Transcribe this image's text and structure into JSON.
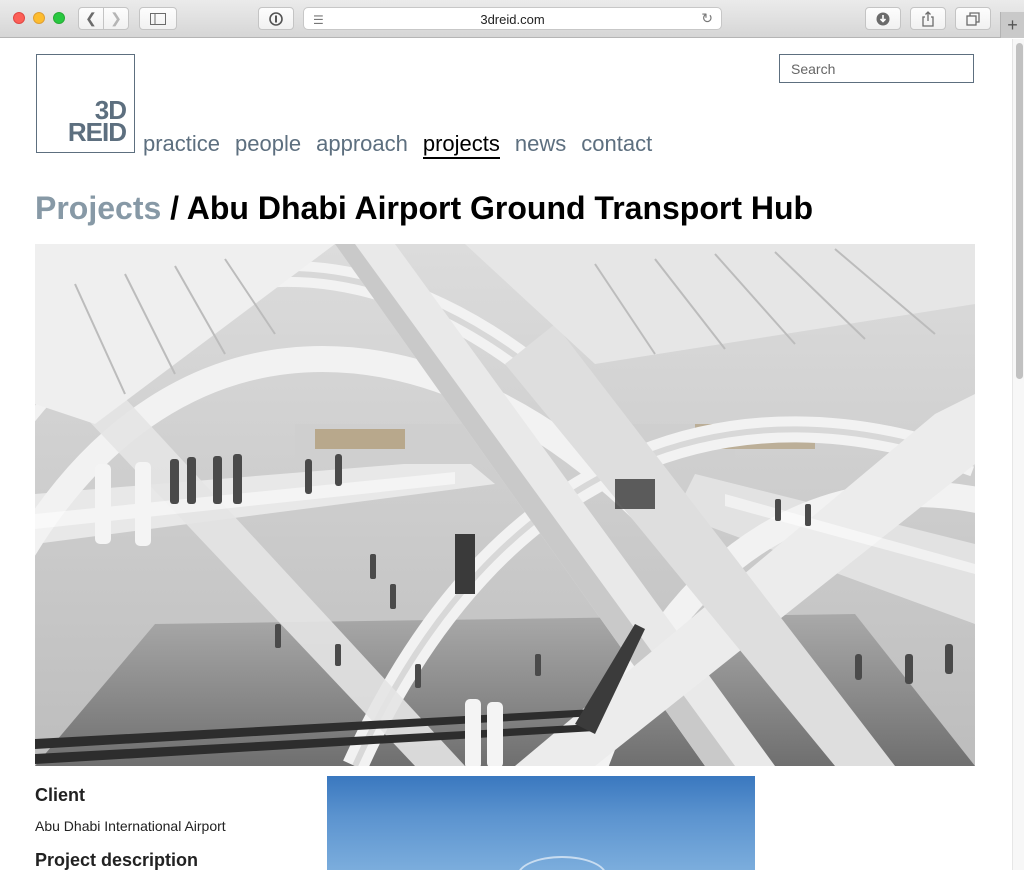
{
  "browser": {
    "url": "3dreid.com",
    "icons": {
      "back": "chevron-left-icon",
      "forward": "chevron-right-icon",
      "sidebar": "sidebar-icon",
      "reader": "privacy-icon",
      "download": "download-icon",
      "share": "share-icon",
      "tabs": "tabs-icon",
      "new_tab": "plus-icon"
    }
  },
  "logo": {
    "line1": "3D",
    "line2": "REID"
  },
  "nav": {
    "items": [
      {
        "label": "practice"
      },
      {
        "label": "people"
      },
      {
        "label": "approach"
      },
      {
        "label": "projects",
        "active": true
      },
      {
        "label": "news"
      },
      {
        "label": "contact"
      }
    ]
  },
  "search": {
    "placeholder": "Search"
  },
  "heading": {
    "crumb": "Projects",
    "separator": " / ",
    "title": "Abu Dhabi Airport Ground Transport Hub"
  },
  "project": {
    "client_label": "Client",
    "client_value": "Abu Dhabi International Airport",
    "description_label": "Project description"
  },
  "colors": {
    "nav": "#5d6f7f",
    "crumb": "#8799a6",
    "active": "#000000"
  }
}
